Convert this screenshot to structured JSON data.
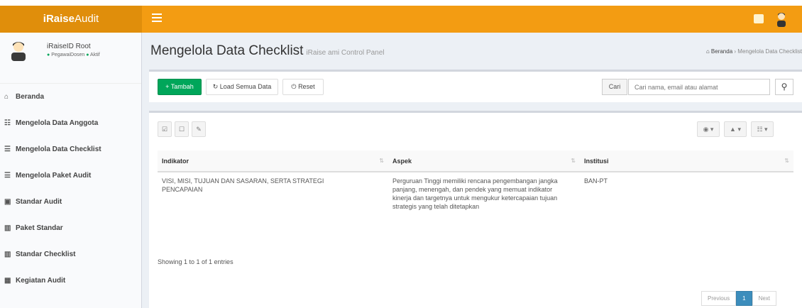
{
  "app": {
    "logo_bold": "iRaise",
    "logo_light": "Audit"
  },
  "user": {
    "name": "iRaiseID Root",
    "role": "PegawaiDosen",
    "status": "Aktif"
  },
  "sidebar": {
    "items": [
      {
        "label": "Beranda",
        "icon": "home-icon"
      },
      {
        "label": "Mengelola Data Anggota",
        "icon": "users-icon"
      },
      {
        "label": "Mengelola Data Checklist",
        "icon": "checklist-icon"
      },
      {
        "label": "Mengelola Paket Audit",
        "icon": "package-icon"
      },
      {
        "label": "Standar Audit",
        "icon": "standard-icon"
      },
      {
        "label": "Paket Standar",
        "icon": "chart-icon"
      },
      {
        "label": "Standar Checklist",
        "icon": "chart-icon"
      },
      {
        "label": "Kegiatan Audit",
        "icon": "calendar-icon"
      }
    ]
  },
  "page": {
    "title": "Mengelola Data Checklist",
    "subtitle": "iRaise ami Control Panel",
    "breadcrumb": {
      "home": "Beranda",
      "current": "Mengelola Data Checklist"
    }
  },
  "toolbar": {
    "add_label": "Tambah",
    "load_label": "Load Semua Data",
    "reset_label": "Reset",
    "search_label": "Cari",
    "search_placeholder": "Cari nama, email atau alamat"
  },
  "table": {
    "columns": [
      "Indikator",
      "Aspek",
      "Institusi"
    ],
    "rows": [
      {
        "indikator": "VISI, MISI, TUJUAN DAN SASARAN, SERTA STRATEGI PENCAPAIAN",
        "aspek": "Perguruan Tinggi memiliki rencana pengembangan jangka panjang, menengah, dan pendek yang memuat indikator kinerja dan targetnya untuk mengukur ketercapaian tujuan strategis yang telah ditetapkan",
        "institusi": "BAN-PT"
      }
    ],
    "info": "Showing 1 to 1 of 1 entries"
  },
  "pagination": {
    "prev": "Previous",
    "current": "1",
    "next": "Next"
  },
  "colors": {
    "header": "#f39c12",
    "logo_bg": "#e08e0b",
    "primary_green": "#00a65a",
    "active_page": "#3c8dbc"
  }
}
